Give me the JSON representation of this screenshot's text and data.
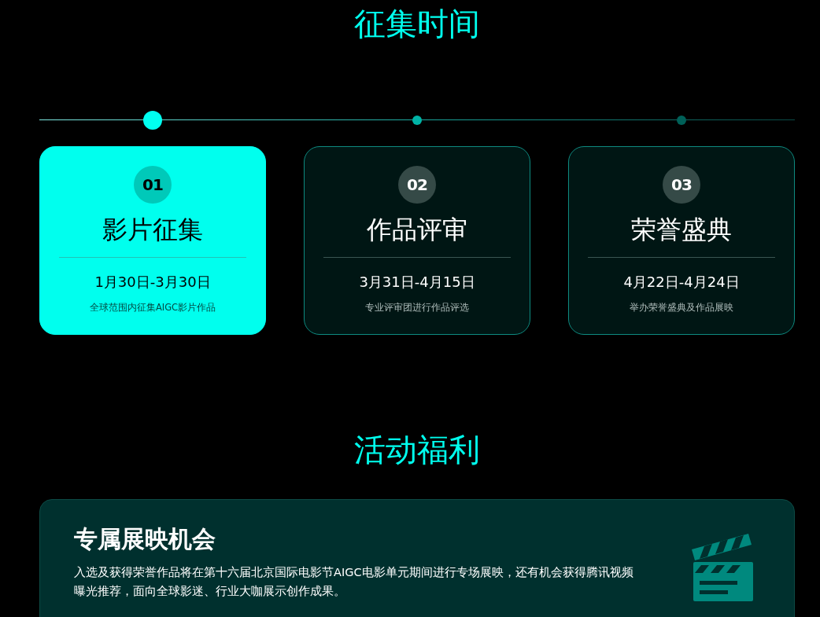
{
  "schedule": {
    "title": "征集时间",
    "stages": [
      {
        "number": "01",
        "name": "影片征集",
        "dates": "1月30日-3月30日",
        "description": "全球范围内征集AIGC影片作品",
        "selected": true,
        "color": "#00fff0"
      },
      {
        "number": "02",
        "name": "作品评审",
        "dates": "3月31日-4月15日",
        "description": "专业评审团进行作品评选",
        "selected": false,
        "color": "#00b3a6"
      },
      {
        "number": "03",
        "name": "荣誉盛典",
        "dates": "4月22日-4月24日",
        "description": "举办荣誉盛典及作品展映",
        "selected": false,
        "color": "#006058"
      }
    ]
  },
  "benefits": {
    "title": "活动福利",
    "items": [
      {
        "title": "专属展映机会",
        "description": "入选及获得荣誉作品将在第十六届北京国际电影节AIGC电影单元期间进行专场展映，还有机会获得腾讯视频曝光推荐，面向全球影迷、行业大咖展示创作成果。"
      }
    ]
  }
}
